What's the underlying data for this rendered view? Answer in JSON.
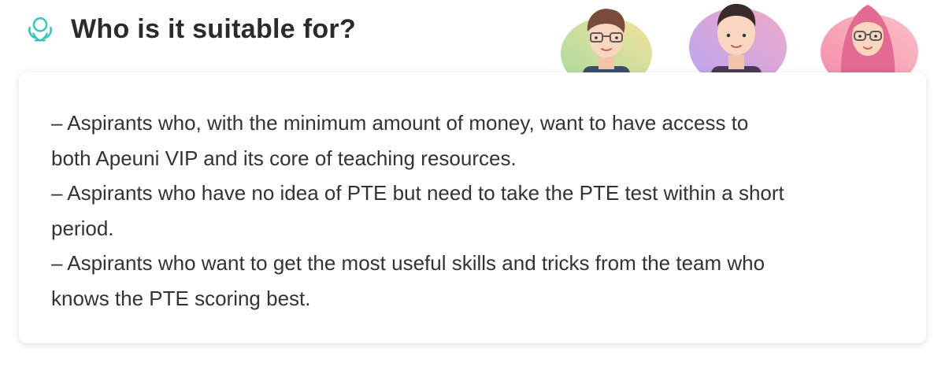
{
  "header": {
    "icon": "lotus-icon",
    "title": "Who is it suitable for?",
    "accent_color": "#2fc7bd"
  },
  "avatars": [
    {
      "name": "avatar-man-glasses",
      "bg_color": "#e6e89a"
    },
    {
      "name": "avatar-man-bald",
      "bg_color": "#c9a8ef"
    },
    {
      "name": "avatar-woman-hijab",
      "bg_color": "#f59bb5"
    }
  ],
  "card": {
    "lines": [
      "– Aspirants who, with the minimum amount of money, want to have access to",
      "both Apeuni VIP and its core of teaching resources.",
      "– Aspirants who have no idea of PTE but need to take the PTE test within a short",
      "period.",
      "– Aspirants who want to get the most useful skills and tricks from the team who",
      "knows the PTE scoring best."
    ]
  }
}
